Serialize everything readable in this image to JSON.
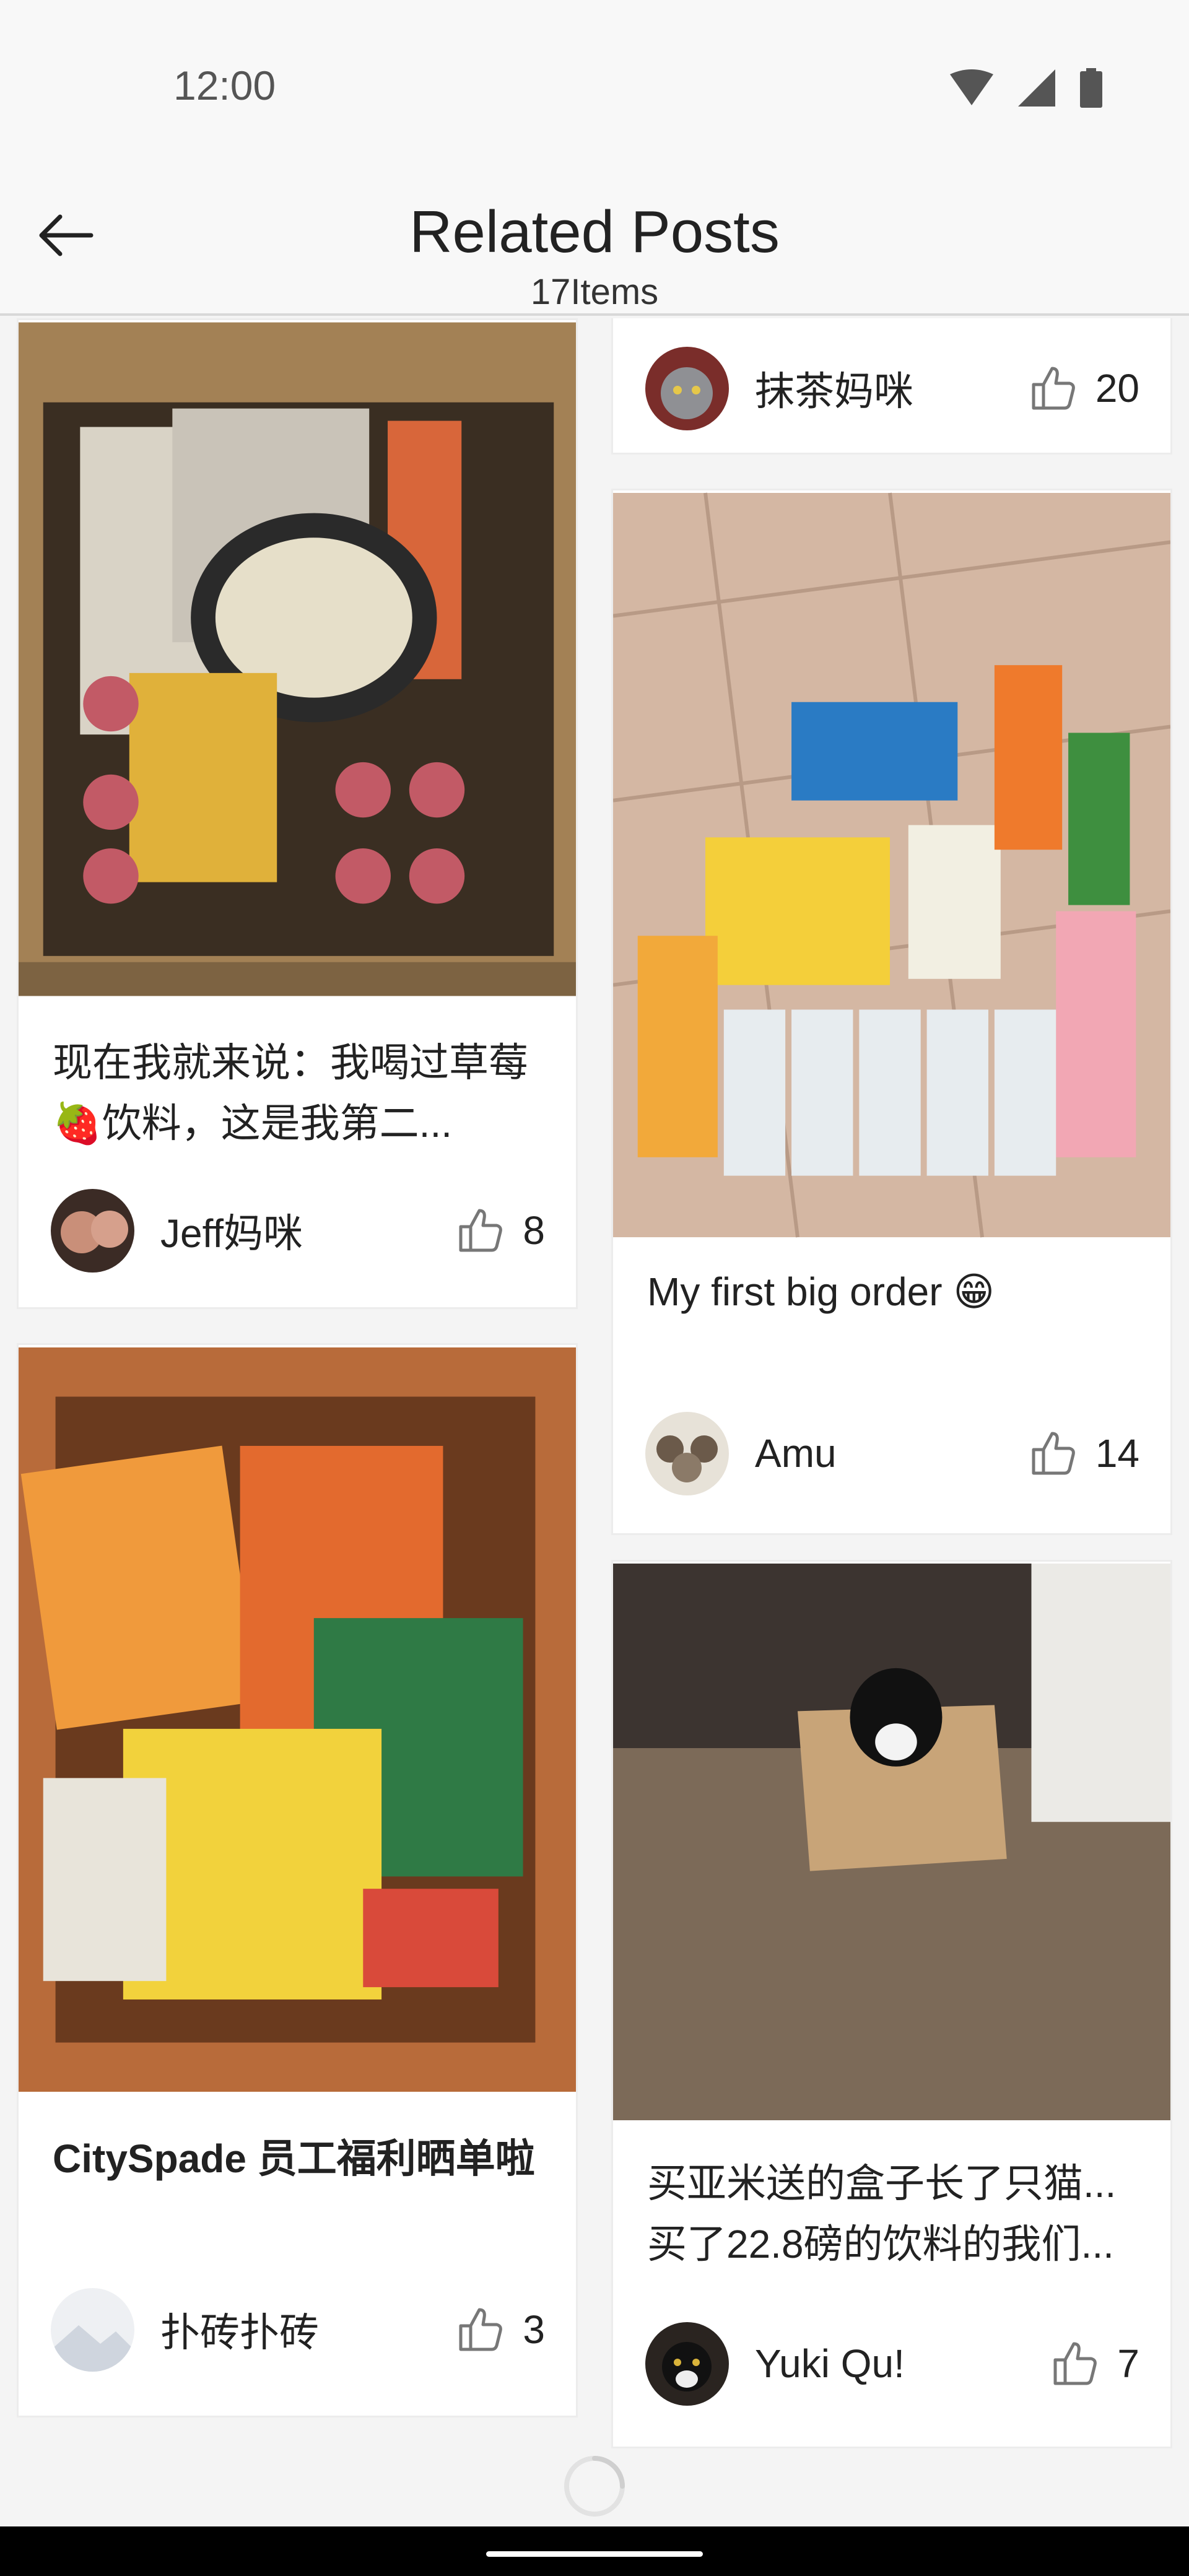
{
  "status_bar": {
    "time": "12:00"
  },
  "header": {
    "title": "Related Posts",
    "count_label": "17Items"
  },
  "posts": [
    {
      "text": "现在我就来说：我喝过草莓🍓饮料，这是我第二...",
      "author": "Jeff妈咪",
      "likes": "8",
      "image": "box-of-snacks-photo"
    },
    {
      "text": "CitySpade 员工福利晒单啦",
      "author": "扑砖扑砖",
      "likes": "3",
      "image": "bag-of-groceries-photo"
    },
    {
      "text": "",
      "author": "抹茶妈咪",
      "likes": "20",
      "image": ""
    },
    {
      "text": "My first big order 😁",
      "author": "Amu",
      "likes": "14",
      "image": "drinks-on-floor-photo"
    },
    {
      "text": "买亚米送的盒子长了只猫... 买了22.8磅的饮料的我们...",
      "author": "Yuki Qu!",
      "likes": "7",
      "image": "cat-in-box-photo"
    }
  ],
  "icons": {
    "back": "arrow-left-icon",
    "like": "thumbs-up-icon",
    "wifi": "wifi-icon",
    "signal": "cell-signal-icon",
    "battery": "battery-icon"
  },
  "colors": {
    "background": "#f4f4f4",
    "card": "#ffffff",
    "text": "#222222"
  }
}
